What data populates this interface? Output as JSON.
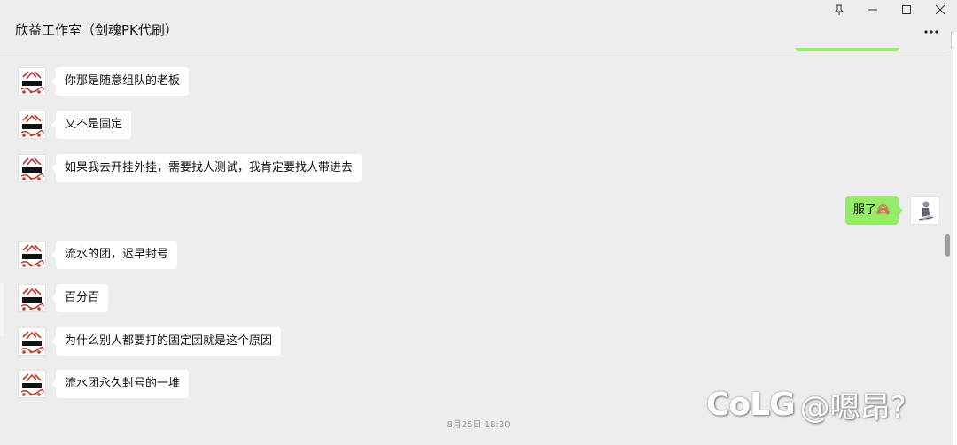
{
  "window": {
    "title": "欣益工作室（剑魂PK代刷）",
    "controls": [
      "pin-icon",
      "minimize-icon",
      "maximize-icon",
      "close-icon"
    ]
  },
  "messages_left": [
    {
      "text": "你那是随意组队的老板"
    },
    {
      "text": "又不是固定"
    },
    {
      "text": "如果我去开挂外挂，需要找人测试，我肯定要找人带进去"
    },
    {
      "text": "流水的团，迟早封号"
    },
    {
      "text": "百分百"
    },
    {
      "text": "为什么别人都要打的固定团就是这个原因"
    },
    {
      "text": "流水团永久封号的一堆"
    }
  ],
  "message_right": {
    "text": "服了🙈"
  },
  "timestamp": "8月25日 18:30",
  "watermark": {
    "logo": "CoLG",
    "handle": "@嗯昂?"
  },
  "colors": {
    "self_bubble": "#95ec69",
    "other_bubble": "#ffffff",
    "background": "#ededed"
  }
}
